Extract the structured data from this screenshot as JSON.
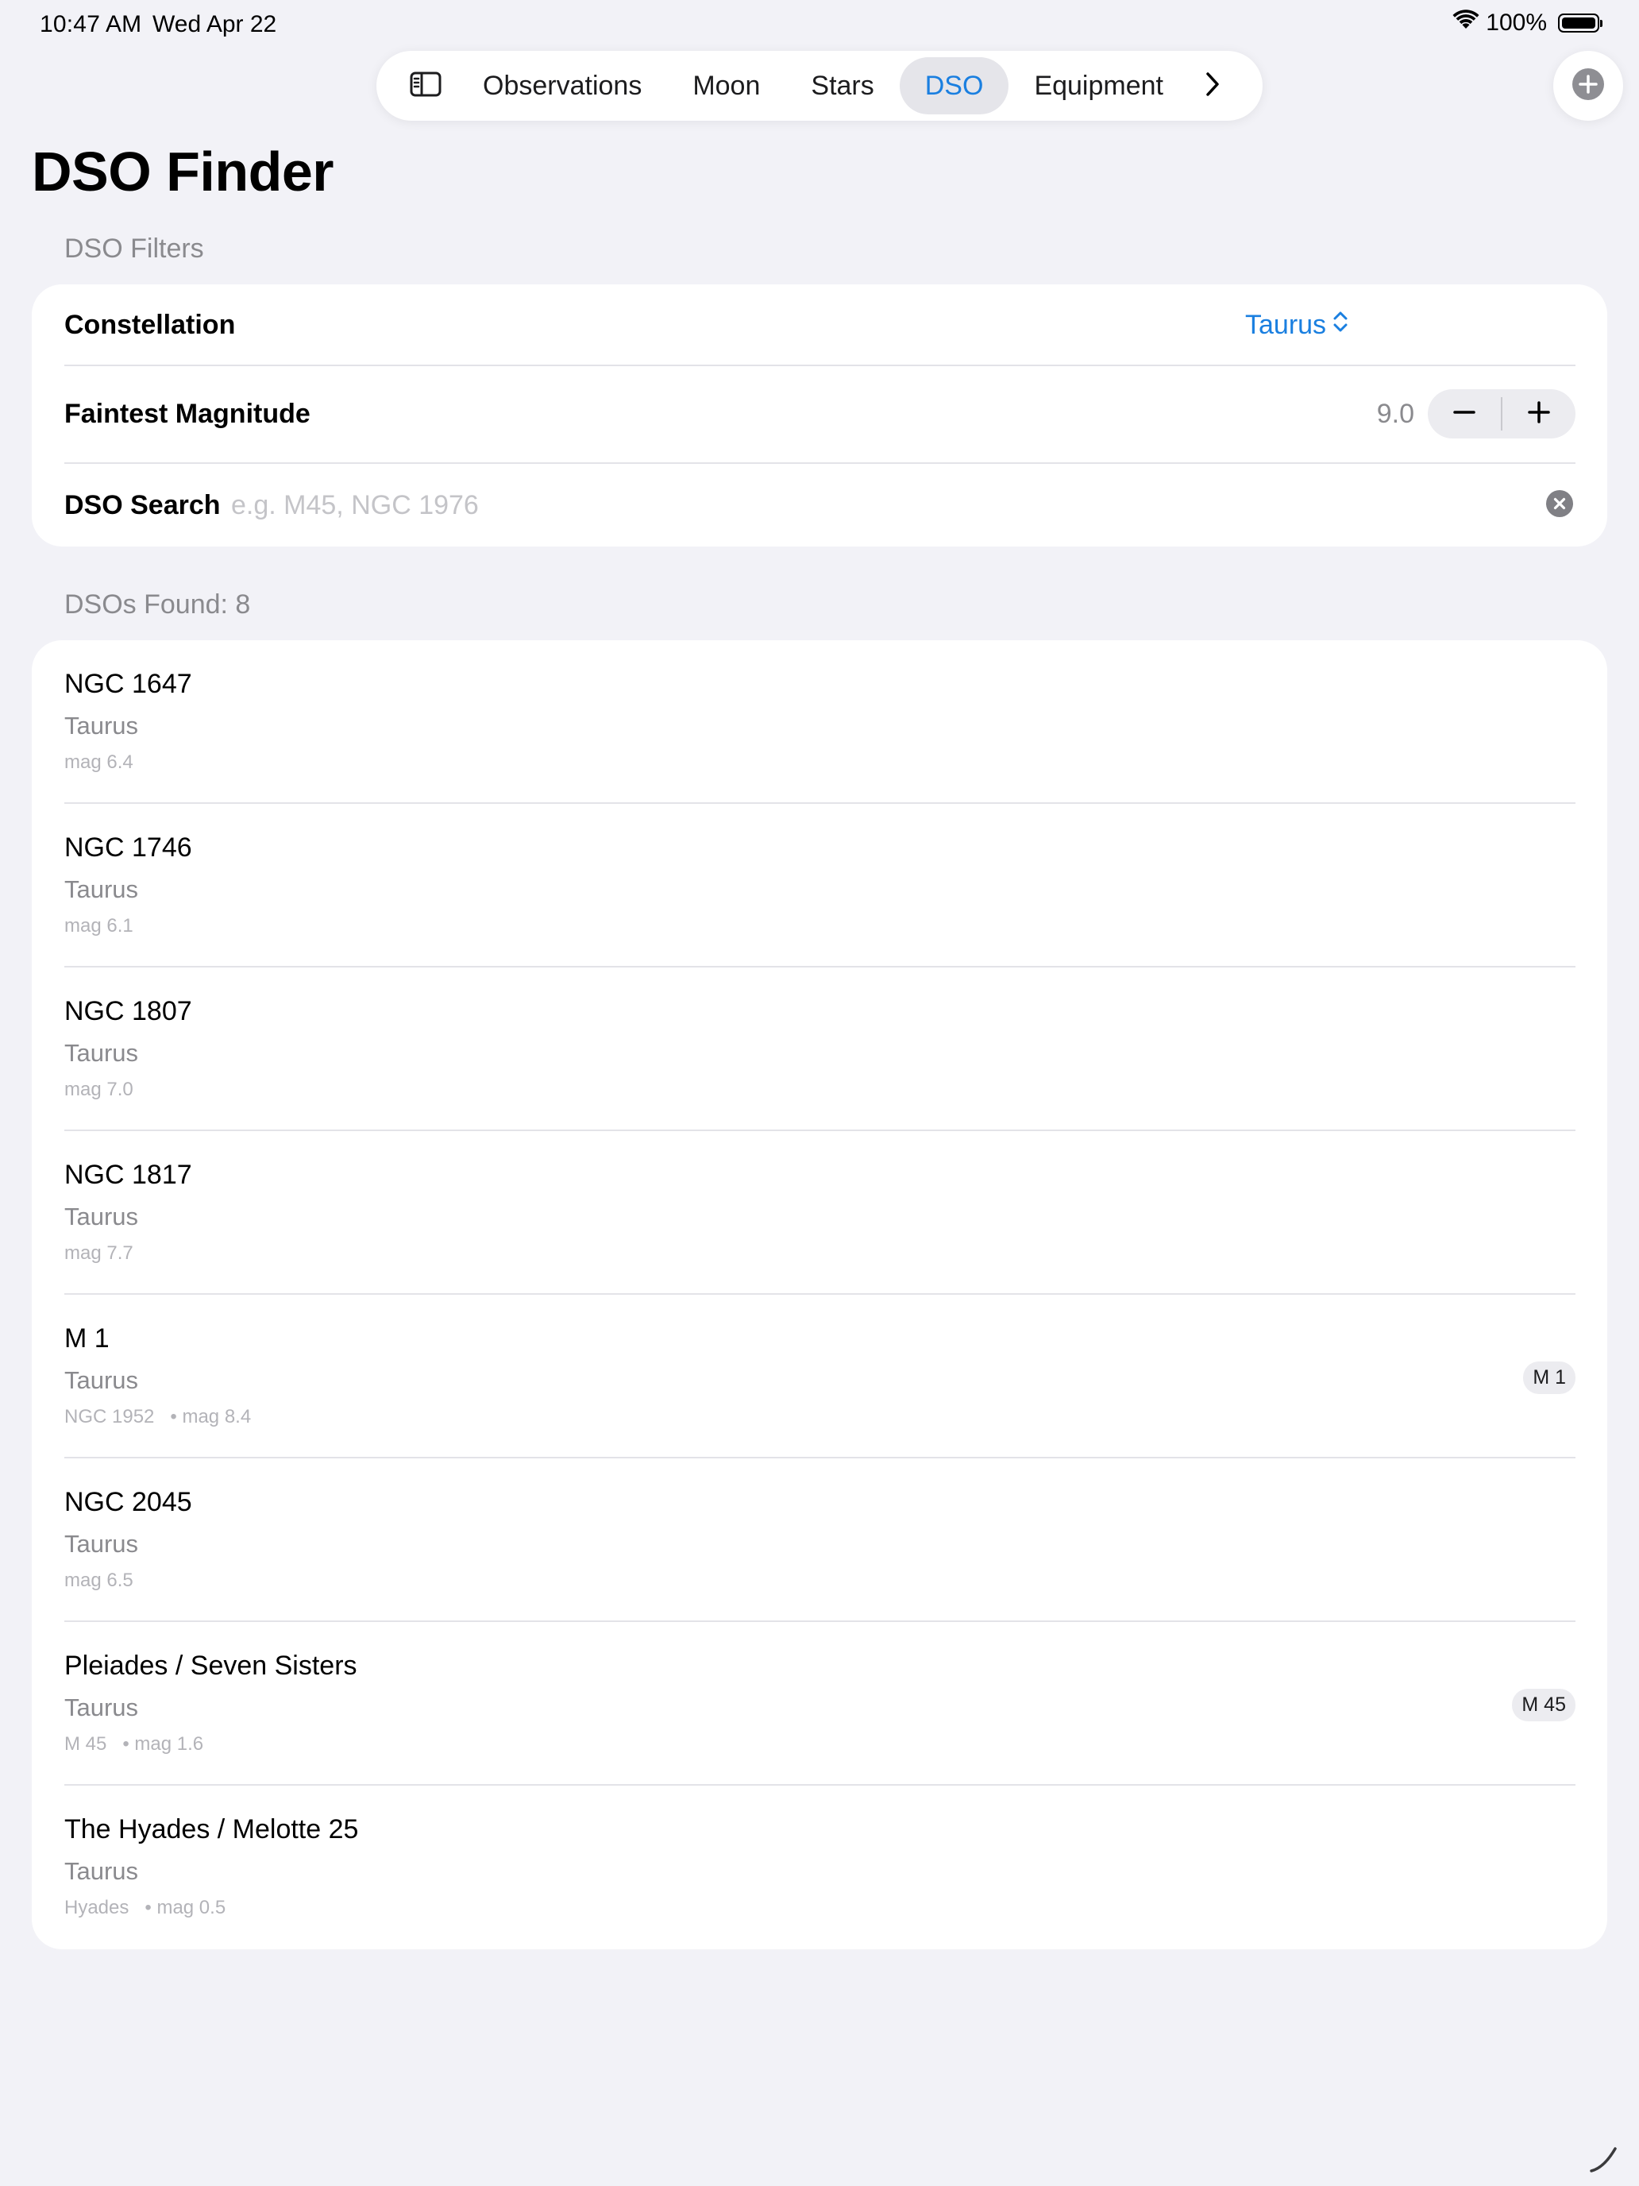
{
  "status_bar": {
    "time": "10:47 AM",
    "date": "Wed Apr 22",
    "battery": "100%",
    "battery_level": 1.0
  },
  "tabs": [
    {
      "label": "Observations",
      "active": false
    },
    {
      "label": "Moon",
      "active": false
    },
    {
      "label": "Stars",
      "active": false
    },
    {
      "label": "DSO",
      "active": true
    },
    {
      "label": "Equipment",
      "active": false
    }
  ],
  "icons": {
    "sidebar_toggle": "sidebar-icon",
    "more_tabs": "chevron-right-icon",
    "add": "plus-circle-icon",
    "wifi": "wifi-icon",
    "battery": "battery-icon",
    "picker": "chevron-up-down-icon",
    "clear": "xmark-circle-icon"
  },
  "colors": {
    "accent": "#1a7fe0",
    "background": "#f2f2f7",
    "secondary_text": "#8a8a8e"
  },
  "page": {
    "title": "DSO Finder"
  },
  "filters": {
    "section_title": "DSO Filters",
    "constellation_label": "Constellation",
    "constellation_value": "Taurus",
    "magnitude_label": "Faintest Magnitude",
    "magnitude_value": "9.0",
    "search_label": "DSO Search",
    "search_placeholder": "e.g. M45, NGC 1976",
    "search_value": ""
  },
  "results": {
    "header": "DSOs Found: 8",
    "items": [
      {
        "name": "NGC 1647",
        "constellation": "Taurus",
        "meta": "mag 6.4",
        "badge": ""
      },
      {
        "name": "NGC 1746",
        "constellation": "Taurus",
        "meta": "mag 6.1",
        "badge": ""
      },
      {
        "name": "NGC 1807",
        "constellation": "Taurus",
        "meta": "mag 7.0",
        "badge": ""
      },
      {
        "name": "NGC 1817",
        "constellation": "Taurus",
        "meta": "mag 7.7",
        "badge": ""
      },
      {
        "name": "M 1",
        "constellation": "Taurus",
        "meta": "NGC 1952   • mag 8.4",
        "badge": "M 1"
      },
      {
        "name": "NGC 2045",
        "constellation": "Taurus",
        "meta": "mag 6.5",
        "badge": ""
      },
      {
        "name": "Pleiades / Seven Sisters",
        "constellation": "Taurus",
        "meta": "M 45   • mag 1.6",
        "badge": "M 45"
      },
      {
        "name": "The Hyades / Melotte 25",
        "constellation": "Taurus",
        "meta": "Hyades   • mag 0.5",
        "badge": ""
      }
    ]
  }
}
